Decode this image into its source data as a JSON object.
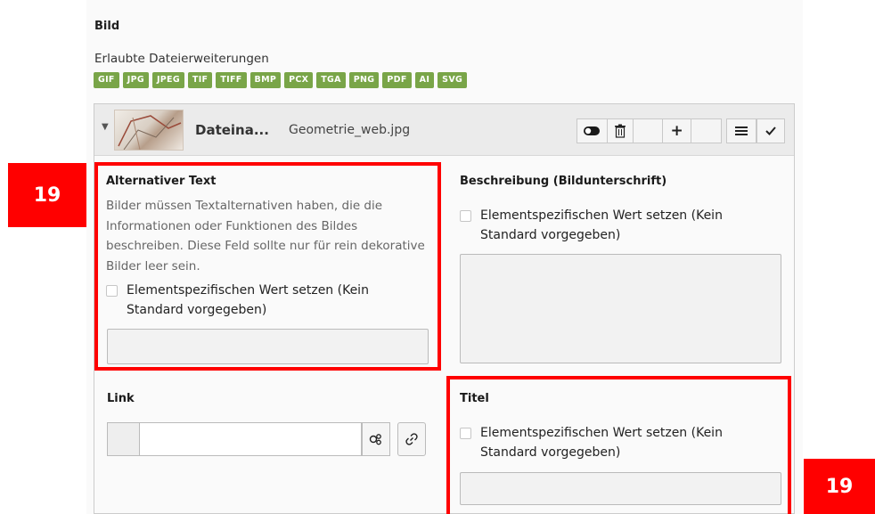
{
  "section": {
    "title": "Bild"
  },
  "extensions": {
    "label": "Erlaubte Dateierweiterungen",
    "items": [
      "GIF",
      "JPG",
      "JPEG",
      "TIF",
      "TIFF",
      "BMP",
      "PCX",
      "TGA",
      "PNG",
      "PDF",
      "AI",
      "SVG"
    ]
  },
  "file": {
    "label": "Dateina...",
    "name": "Geometrie_web.jpg"
  },
  "toolbar": {
    "toggle_icon": "toggle-icon",
    "delete_icon": "trash-icon",
    "add_label": "+",
    "menu_label": "≡",
    "check_label": "✓"
  },
  "alt_text": {
    "title": "Alternativer Text",
    "help": "Bilder müssen Textalternativen haben, die die Informationen oder Funktionen des Bildes beschreiben. Diese Feld sollte nur für rein dekorative Bilder leer sein.",
    "checkbox_label": "Elementspezifischen Wert setzen (Kein Standard vorgegeben)",
    "value": ""
  },
  "description": {
    "title": "Beschreibung (Bildunterschrift)",
    "checkbox_label": "Elementspezifischen Wert setzen (Kein Standard vorgegeben)",
    "value": ""
  },
  "link": {
    "title": "Link",
    "value": ""
  },
  "titel": {
    "title": "Titel",
    "checkbox_label": "Elementspezifischen Wert setzen (Kein Standard vorgegeben)",
    "value": ""
  },
  "annotations": {
    "left_badge": "19",
    "right_badge": "19"
  },
  "colors": {
    "badge_green": "#79a548",
    "annotation_red": "#ff0000"
  }
}
